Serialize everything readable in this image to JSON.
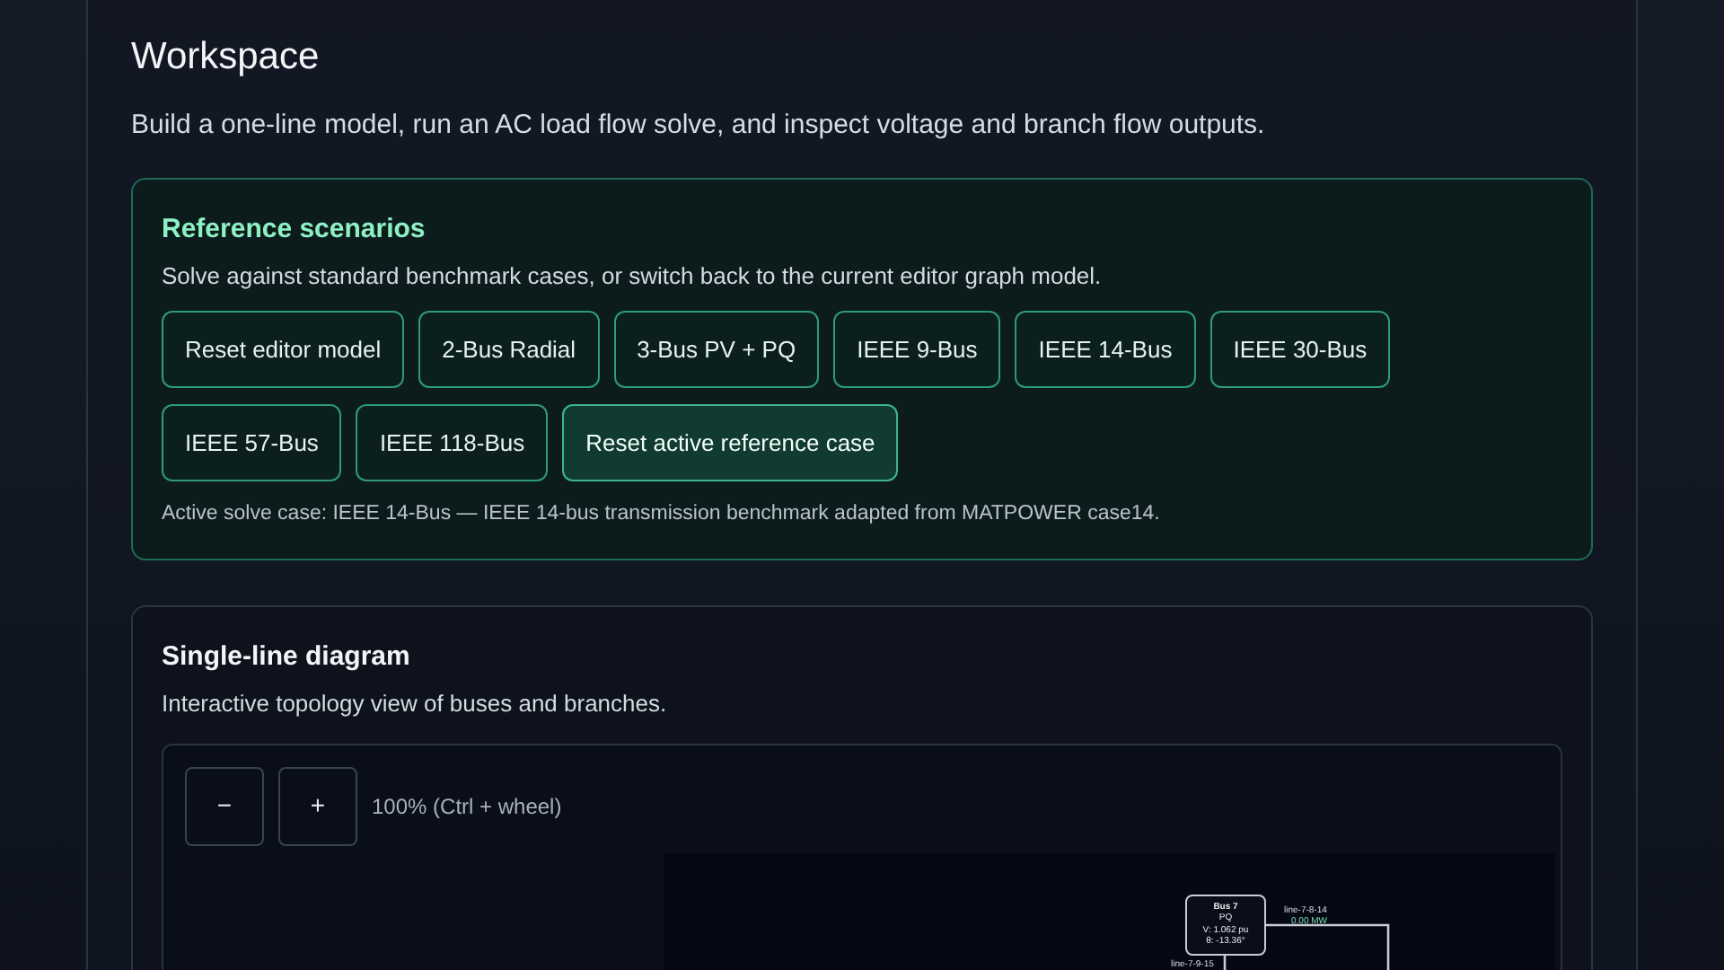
{
  "workspace": {
    "title": "Workspace",
    "description": "Build a one-line model, run an AC load flow solve, and inspect voltage and branch flow outputs."
  },
  "reference": {
    "title": "Reference scenarios",
    "description": "Solve against standard benchmark cases, or switch back to the current editor graph model.",
    "buttons": [
      {
        "label": "Reset editor model",
        "kind": "scenario"
      },
      {
        "label": "2-Bus Radial",
        "kind": "scenario"
      },
      {
        "label": "3-Bus PV + PQ",
        "kind": "scenario"
      },
      {
        "label": "IEEE 9-Bus",
        "kind": "scenario"
      },
      {
        "label": "IEEE 14-Bus",
        "kind": "scenario"
      },
      {
        "label": "IEEE 30-Bus",
        "kind": "scenario"
      },
      {
        "label": "IEEE 57-Bus",
        "kind": "scenario"
      },
      {
        "label": "IEEE 118-Bus",
        "kind": "scenario"
      },
      {
        "label": "Reset active reference case",
        "kind": "accent"
      }
    ],
    "status": "Active solve case: IEEE 14-Bus — IEEE 14-bus transmission benchmark adapted from MATPOWER case14."
  },
  "diagram": {
    "title": "Single-line diagram",
    "description": "Interactive topology view of buses and branches.",
    "zoom_out": "−",
    "zoom_in": "+",
    "zoom_label": "100% (Ctrl + wheel)",
    "bus": {
      "name": "Bus 7",
      "type": "PQ",
      "voltage": "V: 1.062 pu",
      "angle": "θ: -13.36°"
    },
    "branch": {
      "name": "line-7-8-14",
      "flow": "0.00 MW"
    },
    "branch_below": {
      "name": "line-7-9-15"
    }
  }
}
